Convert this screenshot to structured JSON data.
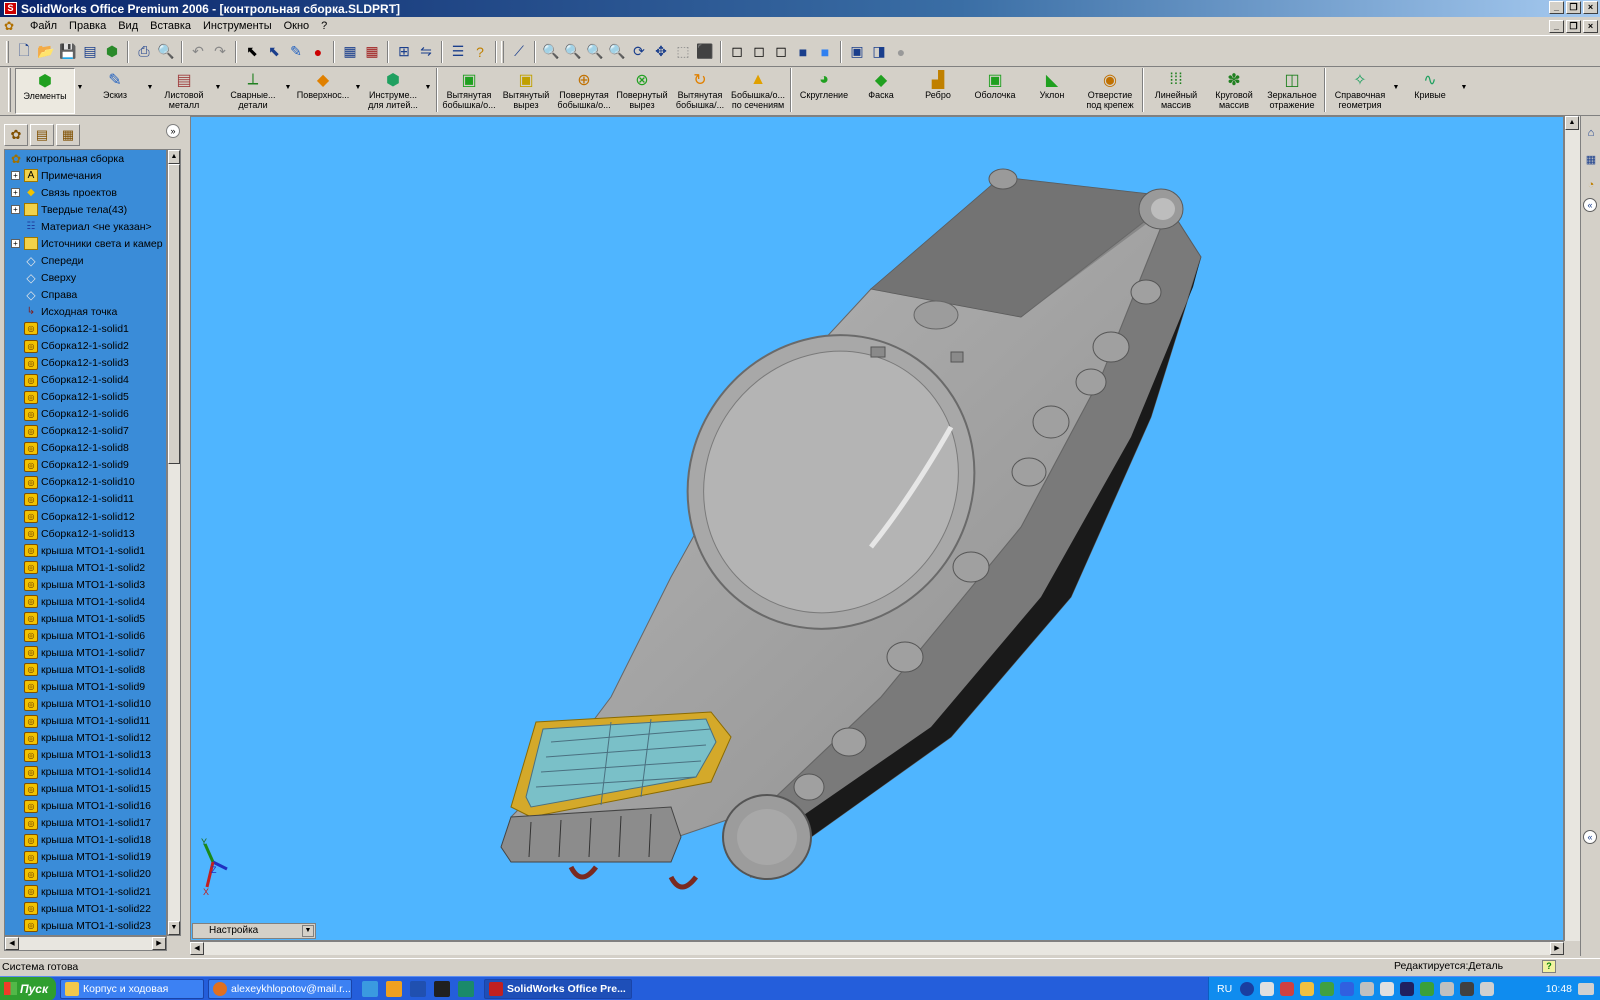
{
  "window": {
    "title": "SolidWorks Office Premium 2006 - [контрольная сборка.SLDPRT]",
    "app_icon": "solidworks-logo-icon"
  },
  "menu": {
    "items": [
      "Файл",
      "Правка",
      "Вид",
      "Вставка",
      "Инструменты",
      "Окно",
      "?"
    ]
  },
  "features_toolbar": {
    "items": [
      {
        "label": "Элементы",
        "icon": "features-icon",
        "active": true,
        "dropdown": true
      },
      {
        "label": "Эскиз",
        "icon": "sketch-icon",
        "dropdown": true
      },
      {
        "label": "Листовой\nметалл",
        "icon": "sheet-metal-icon",
        "dropdown": true
      },
      {
        "label": "Сварные...\nдетали",
        "icon": "weldments-icon",
        "dropdown": true
      },
      {
        "label": "Поверхнос...",
        "icon": "surfaces-icon",
        "dropdown": true
      },
      {
        "label": "Инструме...\nдля литей...",
        "icon": "mold-tools-icon",
        "dropdown": true
      },
      {
        "label": "Вытянутая\nбобышка/о...",
        "icon": "extruded-boss-icon"
      },
      {
        "label": "Вытянутый\nвырез",
        "icon": "extruded-cut-icon"
      },
      {
        "label": "Повернутая\nбобышка/о...",
        "icon": "revolved-boss-icon"
      },
      {
        "label": "Повернутый\nвырез",
        "icon": "revolved-cut-icon"
      },
      {
        "label": "Вытянутая\nбобышка/...",
        "icon": "swept-boss-icon"
      },
      {
        "label": "Бобышка/о...\nпо сечениям",
        "icon": "lofted-boss-icon"
      },
      {
        "label": "Скругление",
        "icon": "fillet-icon"
      },
      {
        "label": "Фаска",
        "icon": "chamfer-icon"
      },
      {
        "label": "Ребро",
        "icon": "rib-icon"
      },
      {
        "label": "Оболочка",
        "icon": "shell-icon"
      },
      {
        "label": "Уклон",
        "icon": "draft-icon"
      },
      {
        "label": "Отверстие\nпод крепеж",
        "icon": "hole-wizard-icon"
      },
      {
        "label": "Линейный\nмассив",
        "icon": "linear-pattern-icon"
      },
      {
        "label": "Круговой\nмассив",
        "icon": "circular-pattern-icon"
      },
      {
        "label": "Зеркальное\nотражение",
        "icon": "mirror-icon"
      },
      {
        "label": "Справочная\nгеометрия",
        "icon": "reference-geometry-icon",
        "dropdown": true
      },
      {
        "label": "Кривые",
        "icon": "curves-icon",
        "dropdown": true
      }
    ]
  },
  "feature_tree": {
    "root": "контрольная сборка",
    "items": [
      {
        "label": "Примечания",
        "icon": "annotations-icon",
        "expandable": true
      },
      {
        "label": "Связь проектов",
        "icon": "design-binder-icon",
        "expandable": true
      },
      {
        "label": "Твердые тела(43)",
        "icon": "solid-bodies-folder-icon",
        "expandable": true
      },
      {
        "label": "Материал <не указан>",
        "icon": "material-icon",
        "expandable": false
      },
      {
        "label": "Источники света и камер",
        "icon": "lights-cameras-icon",
        "expandable": true
      },
      {
        "label": "Спереди",
        "icon": "plane-icon",
        "expandable": false
      },
      {
        "label": "Сверху",
        "icon": "plane-icon",
        "expandable": false
      },
      {
        "label": "Справа",
        "icon": "plane-icon",
        "expandable": false
      },
      {
        "label": "Исходная точка",
        "icon": "origin-icon",
        "expandable": false
      },
      {
        "label": "Сборка12-1-solid1",
        "icon": "solid-body-icon"
      },
      {
        "label": "Сборка12-1-solid2",
        "icon": "solid-body-icon"
      },
      {
        "label": "Сборка12-1-solid3",
        "icon": "solid-body-icon"
      },
      {
        "label": "Сборка12-1-solid4",
        "icon": "solid-body-icon"
      },
      {
        "label": "Сборка12-1-solid5",
        "icon": "solid-body-icon"
      },
      {
        "label": "Сборка12-1-solid6",
        "icon": "solid-body-icon"
      },
      {
        "label": "Сборка12-1-solid7",
        "icon": "solid-body-icon"
      },
      {
        "label": "Сборка12-1-solid8",
        "icon": "solid-body-icon"
      },
      {
        "label": "Сборка12-1-solid9",
        "icon": "solid-body-icon"
      },
      {
        "label": "Сборка12-1-solid10",
        "icon": "solid-body-icon"
      },
      {
        "label": "Сборка12-1-solid11",
        "icon": "solid-body-icon"
      },
      {
        "label": "Сборка12-1-solid12",
        "icon": "solid-body-icon"
      },
      {
        "label": "Сборка12-1-solid13",
        "icon": "solid-body-icon"
      },
      {
        "label": "крыша МТО1-1-solid1",
        "icon": "solid-body-icon"
      },
      {
        "label": "крыша МТО1-1-solid2",
        "icon": "solid-body-icon"
      },
      {
        "label": "крыша МТО1-1-solid3",
        "icon": "solid-body-icon"
      },
      {
        "label": "крыша МТО1-1-solid4",
        "icon": "solid-body-icon"
      },
      {
        "label": "крыша МТО1-1-solid5",
        "icon": "solid-body-icon"
      },
      {
        "label": "крыша МТО1-1-solid6",
        "icon": "solid-body-icon"
      },
      {
        "label": "крыша МТО1-1-solid7",
        "icon": "solid-body-icon"
      },
      {
        "label": "крыша МТО1-1-solid8",
        "icon": "solid-body-icon"
      },
      {
        "label": "крыша МТО1-1-solid9",
        "icon": "solid-body-icon"
      },
      {
        "label": "крыша МТО1-1-solid10",
        "icon": "solid-body-icon"
      },
      {
        "label": "крыша МТО1-1-solid11",
        "icon": "solid-body-icon"
      },
      {
        "label": "крыша МТО1-1-solid12",
        "icon": "solid-body-icon"
      },
      {
        "label": "крыша МТО1-1-solid13",
        "icon": "solid-body-icon"
      },
      {
        "label": "крыша МТО1-1-solid14",
        "icon": "solid-body-icon"
      },
      {
        "label": "крыша МТО1-1-solid15",
        "icon": "solid-body-icon"
      },
      {
        "label": "крыша МТО1-1-solid16",
        "icon": "solid-body-icon"
      },
      {
        "label": "крыша МТО1-1-solid17",
        "icon": "solid-body-icon"
      },
      {
        "label": "крыша МТО1-1-solid18",
        "icon": "solid-body-icon"
      },
      {
        "label": "крыша МТО1-1-solid19",
        "icon": "solid-body-icon"
      },
      {
        "label": "крыша МТО1-1-solid20",
        "icon": "solid-body-icon"
      },
      {
        "label": "крыша МТО1-1-solid21",
        "icon": "solid-body-icon"
      },
      {
        "label": "крыша МТО1-1-solid22",
        "icon": "solid-body-icon"
      },
      {
        "label": "крыша МТО1-1-solid23",
        "icon": "solid-body-icon"
      }
    ]
  },
  "viewport": {
    "background_color": "#4fb5ff",
    "configuration_tab": "Настройка",
    "triad_labels": {
      "x": "X",
      "y": "Y",
      "z": "Z"
    }
  },
  "statusbar": {
    "text": "Система готова",
    "edit_state": "Редактируется:Деталь"
  },
  "taskbar": {
    "start_label": "Пуск",
    "buttons": [
      {
        "label": "Корпус и ходовая",
        "icon": "folder-icon",
        "active": false
      },
      {
        "label": "alexeykhlopotov@mail.r...",
        "icon": "firefox-icon",
        "active": false
      },
      {
        "label": "SolidWorks Office Pre...",
        "icon": "solidworks-icon",
        "active": true
      }
    ],
    "tray": {
      "lang": "RU",
      "clock": "10:48"
    }
  },
  "colors": {
    "accent": "#0a246a",
    "tree_background": "#3a8cd8",
    "viewport_background": "#4fb5ff",
    "taskbar": "#245edb"
  }
}
